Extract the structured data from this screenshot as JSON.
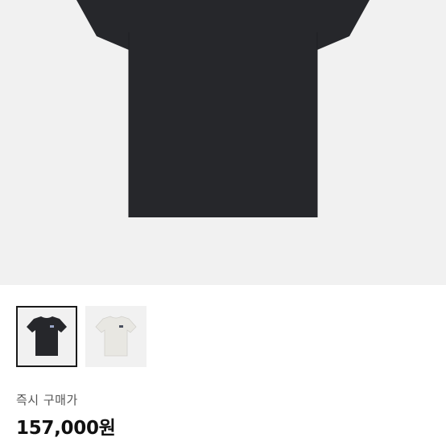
{
  "product": {
    "main_image": "black-tshirt-photo",
    "thumbnails": [
      {
        "name": "black-tshirt-thumbnail",
        "selected": true,
        "color": "#26272b"
      },
      {
        "name": "white-tshirt-thumbnail",
        "selected": false,
        "color": "#e8e7e2"
      }
    ],
    "purchase_label": "즉시 구매가",
    "price": "157,000원"
  },
  "colors": {
    "shirt_dark": "#26272b",
    "shirt_light": "#e8e7e2",
    "background": "#f1f1f1"
  }
}
